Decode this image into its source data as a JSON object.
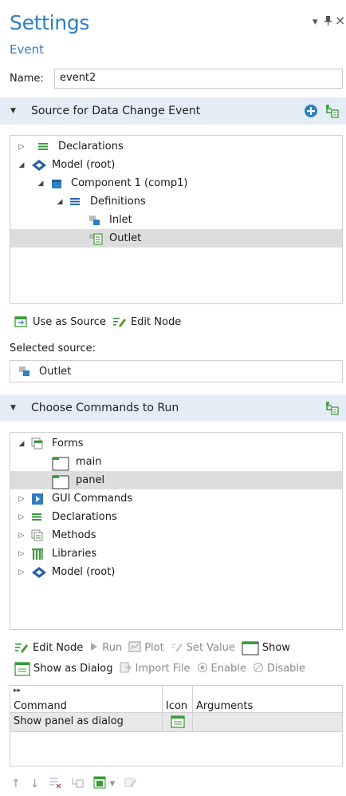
{
  "header": {
    "title": "Settings",
    "subtitle": "Event",
    "dropdown_glyph": "▾",
    "pin_glyph": "⊥",
    "close_glyph": "×"
  },
  "name_field": {
    "label": "Name:",
    "value": "event2"
  },
  "source_section": {
    "title": "Source for Data Change Event",
    "tree": [
      {
        "label": "Declarations",
        "icon": "declarations-icon"
      },
      {
        "label": "Model (root)",
        "icon": "model-icon"
      },
      {
        "label": "Component 1 (comp1)",
        "icon": "component-icon"
      },
      {
        "label": "Definitions",
        "icon": "definitions-icon"
      },
      {
        "label": "Inlet",
        "icon": "variable-icon"
      },
      {
        "label": "Outlet",
        "icon": "variable-table-icon"
      }
    ],
    "use_as_source": "Use as Source",
    "edit_node": "Edit Node",
    "selected_label": "Selected source:",
    "selected_value": "Outlet"
  },
  "commands_section": {
    "title": "Choose Commands to Run",
    "tree": [
      {
        "label": "Forms"
      },
      {
        "label": "main"
      },
      {
        "label": "panel"
      },
      {
        "label": "GUI Commands"
      },
      {
        "label": "Declarations"
      },
      {
        "label": "Methods"
      },
      {
        "label": "Libraries"
      },
      {
        "label": "Model (root)"
      }
    ],
    "toolbar1": {
      "edit_node": "Edit Node",
      "run": "Run",
      "plot": "Plot",
      "set_value": "Set Value",
      "show": "Show"
    },
    "toolbar2": {
      "show_as_dialog": "Show as Dialog",
      "import_file": "Import File",
      "enable": "Enable",
      "disable": "Disable"
    },
    "table": {
      "columns": [
        "Command",
        "Icon",
        "Arguments"
      ],
      "rows": [
        {
          "command": "Show panel as dialog",
          "icon": "dialog-icon",
          "arguments": ""
        }
      ]
    }
  },
  "colors": {
    "accent": "#2f7fc4",
    "section_bg": "#e4ecf5",
    "selection": "#dddddd"
  }
}
